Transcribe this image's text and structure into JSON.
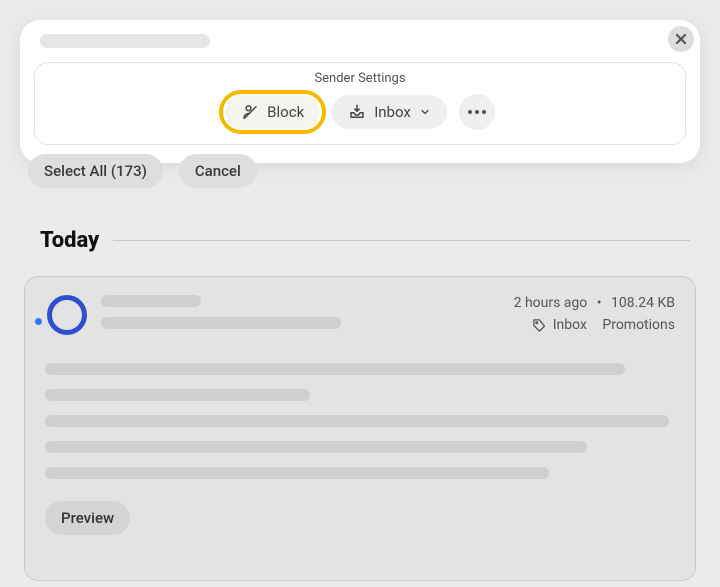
{
  "panel": {
    "title": "Sender Settings",
    "block_label": "Block",
    "inbox_label": "Inbox"
  },
  "actions": {
    "select_all": "Select All (173)",
    "cancel": "Cancel"
  },
  "list": {
    "section_heading": "Today"
  },
  "message": {
    "time_ago": "2 hours ago",
    "separator": "•",
    "size": "108.24 KB",
    "folder": "Inbox",
    "category": "Promotions",
    "preview_label": "Preview"
  }
}
